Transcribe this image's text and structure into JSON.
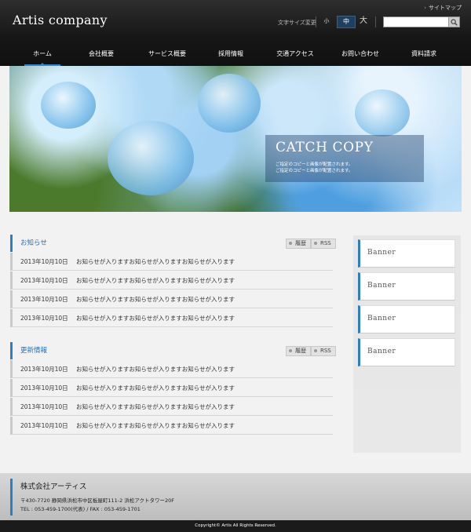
{
  "header": {
    "logo": "Artis company",
    "sitemap": "サイトマップ",
    "fontsize_label": "文字サイズ変更",
    "fontsize": {
      "small": "小",
      "medium": "中",
      "large": "大"
    },
    "search": {
      "value": "",
      "placeholder": ""
    }
  },
  "nav": [
    "ホーム",
    "会社概要",
    "サービス概要",
    "採用情報",
    "交通アクセス",
    "お問い合わせ",
    "資料請求"
  ],
  "hero": {
    "catch_title": "CATCH COPY",
    "catch_line1": "ご指定のコピーと画像が配置されます。",
    "catch_line2": "ご指定のコピーと画像が配置されます。"
  },
  "news": {
    "title": "お知らせ",
    "history_label": "履歴",
    "rss_label": "RSS",
    "items": [
      {
        "date": "2013年10月10日",
        "text": "お知らせが入りますお知らせが入りますお知らせが入ります"
      },
      {
        "date": "2013年10月10日",
        "text": "お知らせが入りますお知らせが入りますお知らせが入ります"
      },
      {
        "date": "2013年10月10日",
        "text": "お知らせが入りますお知らせが入りますお知らせが入ります"
      },
      {
        "date": "2013年10月10日",
        "text": "お知らせが入りますお知らせが入りますお知らせが入ります"
      }
    ]
  },
  "updates": {
    "title": "更新情報",
    "history_label": "履歴",
    "rss_label": "RSS",
    "items": [
      {
        "date": "2013年10月10日",
        "text": "お知らせが入りますお知らせが入りますお知らせが入ります"
      },
      {
        "date": "2013年10月10日",
        "text": "お知らせが入りますお知らせが入りますお知らせが入ります"
      },
      {
        "date": "2013年10月10日",
        "text": "お知らせが入りますお知らせが入りますお知らせが入ります"
      },
      {
        "date": "2013年10月10日",
        "text": "お知らせが入りますお知らせが入りますお知らせが入ります"
      }
    ]
  },
  "banners": [
    "Banner",
    "Banner",
    "Banner",
    "Banner"
  ],
  "footer": {
    "company": "株式会社アーティス",
    "address": "〒430-7720 静岡県浜松市中区板屋町111-2 浜松アクトタワー20F",
    "tel": "TEL : 053-459-1700(代表) / FAX : 053-459-1701",
    "copyright": "Copyright© Artis All Rights Reserved."
  },
  "colors": {
    "accent": "#2e7fbf",
    "header_bg": "#1a1a1a",
    "footer_bg": "#c9c9c9"
  }
}
